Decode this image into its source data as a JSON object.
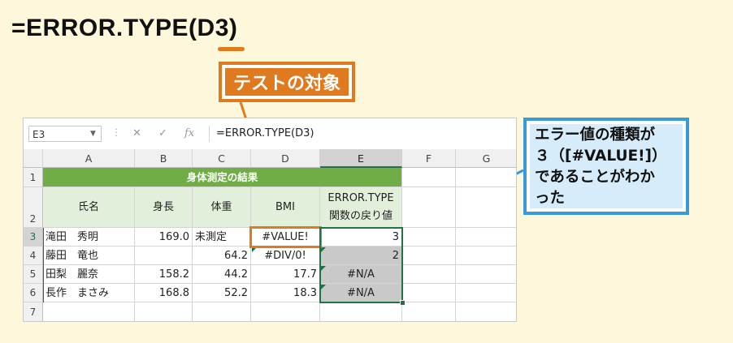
{
  "formula_title": "=ERROR.TYPE(D3)",
  "callout_target": "テストの対象",
  "callout_result": [
    "エラー値の種類が",
    "３（[#VALUE!]）",
    "であることがわか",
    "った"
  ],
  "namebox": "E3",
  "formula_bar": "=ERROR.TYPE(D3)",
  "icons": {
    "cancel": "✕",
    "enter": "✓",
    "function": "fx"
  },
  "columns": [
    "A",
    "B",
    "C",
    "D",
    "E",
    "F",
    "G"
  ],
  "rows": [
    "1",
    "2",
    "3",
    "4",
    "5",
    "6",
    "7"
  ],
  "table_title": "身体測定の結果",
  "headers": {
    "name": "氏名",
    "height": "身長",
    "weight": "体重",
    "bmi": "BMI",
    "error_type_1": "ERROR.TYPE",
    "error_type_2": "関数の戻り値"
  },
  "data_rows": [
    {
      "name": "滝田　秀明",
      "height": "169.0",
      "weight": "未測定",
      "bmi": "#VALUE!",
      "result": "3"
    },
    {
      "name": "藤田　竜也",
      "height": "",
      "weight": "64.2",
      "bmi": "#DIV/0!",
      "result": "2"
    },
    {
      "name": "田梨　麗奈",
      "height": "158.2",
      "weight": "44.2",
      "bmi": "17.7",
      "result": "#N/A"
    },
    {
      "name": "長作　まさみ",
      "height": "168.8",
      "weight": "52.2",
      "bmi": "18.3",
      "result": "#N/A"
    }
  ],
  "colors": {
    "accent_orange": "#e07a1f",
    "accent_blue": "#3a9ad9",
    "excel_green": "#217346",
    "title_green": "#70ad47"
  }
}
